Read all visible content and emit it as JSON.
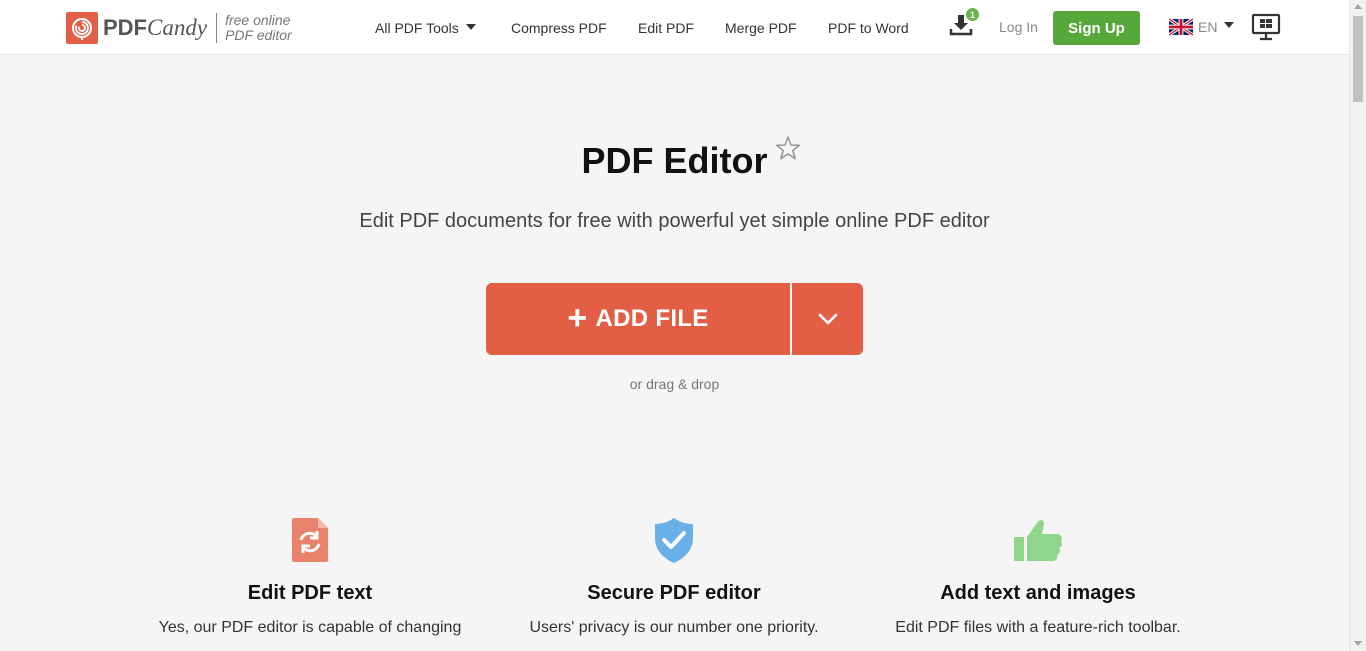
{
  "header": {
    "logo": {
      "brand_pdf": "PDF",
      "brand_candy": "Candy",
      "tagline_line1": "free online",
      "tagline_line2": "PDF editor"
    },
    "nav": {
      "all_tools": "All PDF Tools",
      "compress": "Compress PDF",
      "edit": "Edit PDF",
      "merge": "Merge PDF",
      "to_word": "PDF to Word"
    },
    "download_badge": "1",
    "login": "Log In",
    "signup": "Sign Up",
    "language": "EN"
  },
  "hero": {
    "title": "PDF Editor",
    "subtitle": "Edit PDF documents for free with powerful yet simple online PDF editor",
    "add_file": "ADD FILE",
    "drag_drop": "or drag & drop"
  },
  "features": [
    {
      "icon": "file-refresh-icon",
      "title": "Edit PDF text",
      "desc": "Yes, our PDF editor is capable of changing"
    },
    {
      "icon": "shield-check-icon",
      "title": "Secure PDF editor",
      "desc": "Users' privacy is our number one priority."
    },
    {
      "icon": "thumbs-up-icon",
      "title": "Add text and images",
      "desc": "Edit PDF files with a feature-rich toolbar."
    }
  ],
  "colors": {
    "accent": "#e25e45",
    "signup_green": "#56a83a",
    "shield_blue": "#6ab0e8",
    "thumb_green": "#8fd68a",
    "file_orange": "#e9826b"
  }
}
